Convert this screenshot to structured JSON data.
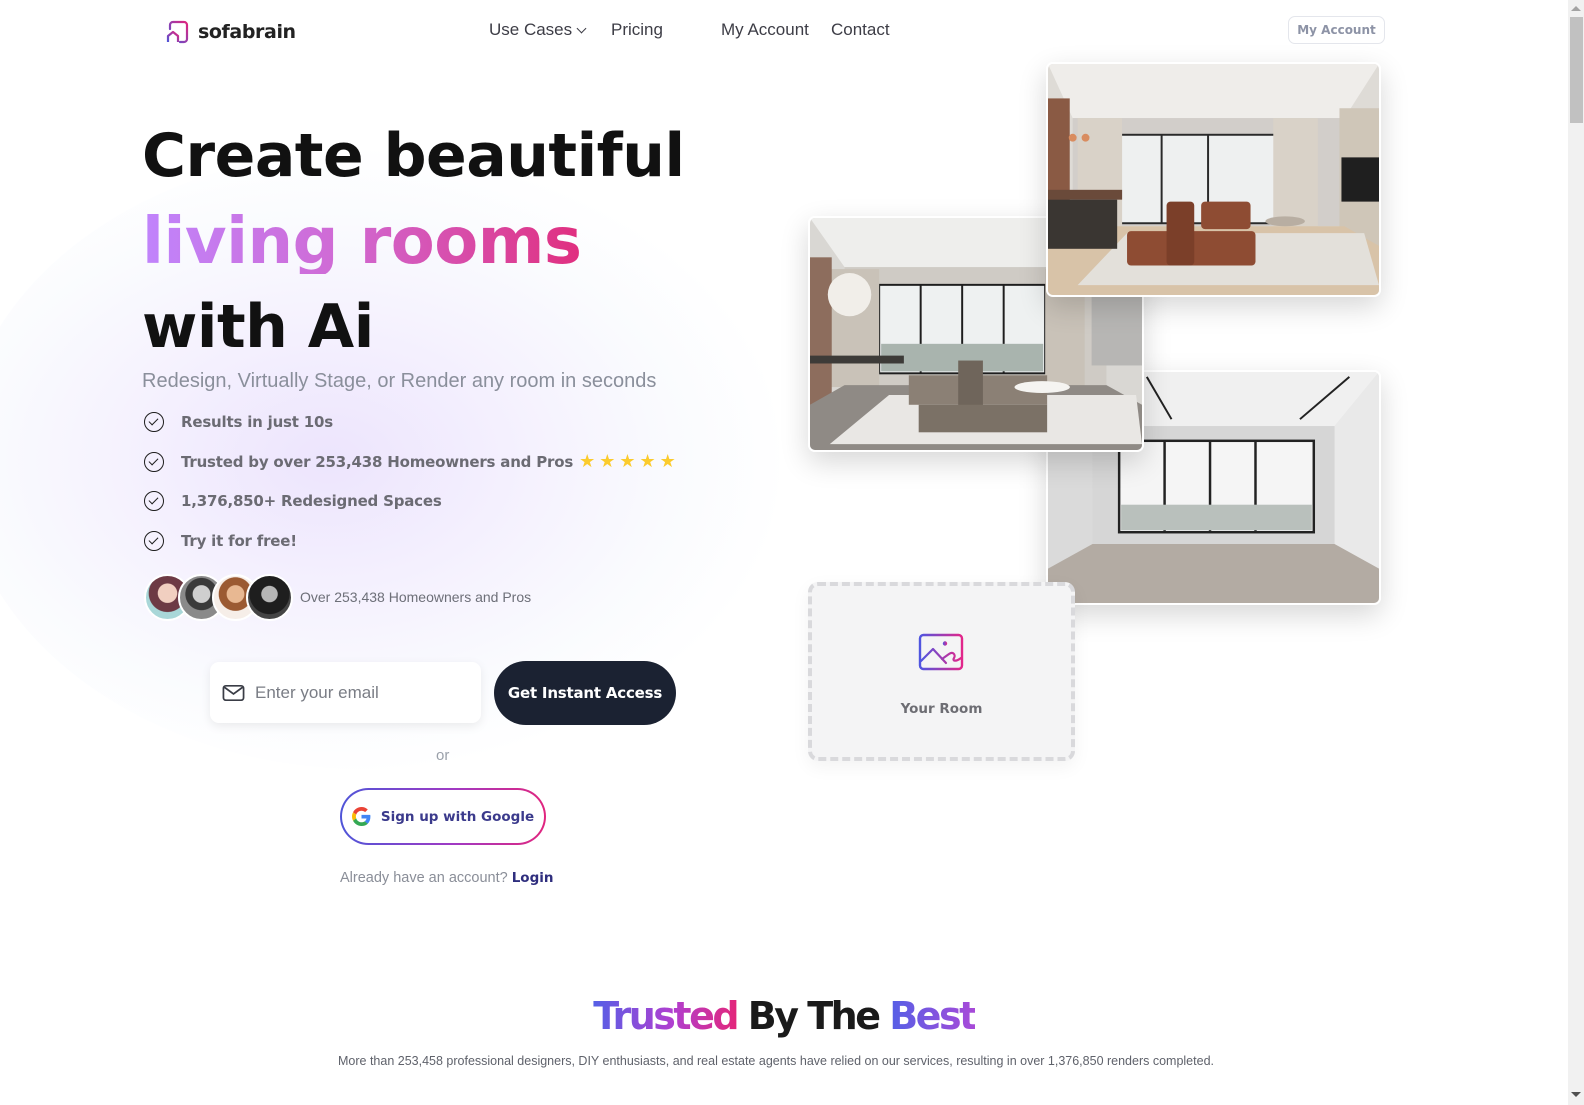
{
  "brand": {
    "name": "sofabrain",
    "logo_icon": "house-outline-icon",
    "accent_gradient": [
      "#4f55d8",
      "#e1257e"
    ]
  },
  "nav": {
    "items": [
      {
        "label": "Use Cases",
        "has_dropdown": true
      },
      {
        "label": "Pricing"
      },
      {
        "label": "My Account"
      },
      {
        "label": "Contact"
      }
    ],
    "account_button": "My Account"
  },
  "hero": {
    "title_line1": "Create beautiful",
    "title_line2": "living rooms",
    "title_line3": "with Ai",
    "subtitle": "Redesign, Virtually Stage, or Render any room in seconds",
    "features": [
      {
        "text": "Results in just 10s",
        "icon": "check-circle-icon"
      },
      {
        "text": "Trusted by over 253,438 Homeowners and Pros",
        "icon": "check-circle-icon",
        "rating_stars": 5
      },
      {
        "text": "1,376,850+ Redesigned Spaces",
        "icon": "check-circle-icon"
      },
      {
        "text": "Try it for free!",
        "icon": "check-circle-icon"
      }
    ],
    "social_proof": "Over 253,438 Homeowners and Pros",
    "email_placeholder": "Enter your email",
    "email_value": "",
    "cta_label": "Get Instant Access",
    "or_label": "or",
    "google_label": "Sign up with Google",
    "login_prompt": "Already have an account?",
    "login_label": "Login",
    "star_color": "#fbcb2d"
  },
  "gallery": {
    "images": [
      {
        "name": "brown-leather-living-room"
      },
      {
        "name": "beige-modern-living-room"
      },
      {
        "name": "empty-room-with-windows"
      }
    ],
    "upload_label": "Your Room",
    "upload_icon": "image-icon"
  },
  "trusted": {
    "title_part1": "Trusted",
    "title_part2": " By The ",
    "title_part3": "Best",
    "subtitle": "More than 253,458 professional designers, DIY enthusiasts, and real estate agents have relied on our services, resulting in over 1,376,850 renders completed."
  }
}
